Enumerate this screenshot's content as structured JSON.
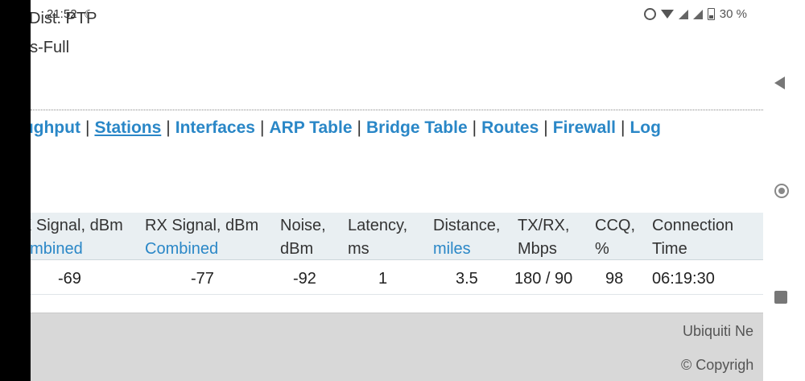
{
  "status_bar": {
    "time": "21:52",
    "battery": "30 %",
    "icons": [
      "dnd-icon",
      "alarm-icon",
      "wifi-icon",
      "signal-icon",
      "signal-icon-2",
      "battery-icon"
    ]
  },
  "header": {
    "cut_text": "l Dist. PTP",
    "speed": "ps-Full"
  },
  "nav": {
    "items": [
      {
        "label": "oughput"
      },
      {
        "label": "Stations"
      },
      {
        "label": "Interfaces"
      },
      {
        "label": "ARP Table"
      },
      {
        "label": "Bridge Table"
      },
      {
        "label": "Routes"
      },
      {
        "label": "Firewall"
      },
      {
        "label": "Log"
      }
    ],
    "separator": "|"
  },
  "table": {
    "headers": [
      {
        "line1": "X Signal, dBm",
        "line2": "ombined"
      },
      {
        "line1": "RX Signal, dBm",
        "line2": "Combined"
      },
      {
        "line1": "Noise,",
        "line2": "dBm"
      },
      {
        "line1": "Latency,",
        "line2": "ms"
      },
      {
        "line1": "Distance,",
        "line2": "miles"
      },
      {
        "line1": "TX/RX,",
        "line2": "Mbps"
      },
      {
        "line1": "CCQ,",
        "line2": "%"
      },
      {
        "line1": "Connection",
        "line2": "Time"
      }
    ],
    "row": [
      "-69",
      "-77",
      "-92",
      "1",
      "3.5",
      "180 / 90",
      "98",
      "06:19:30"
    ]
  },
  "footer": {
    "company": "Ubiquiti Ne",
    "copyright": "© Copyrigh"
  }
}
